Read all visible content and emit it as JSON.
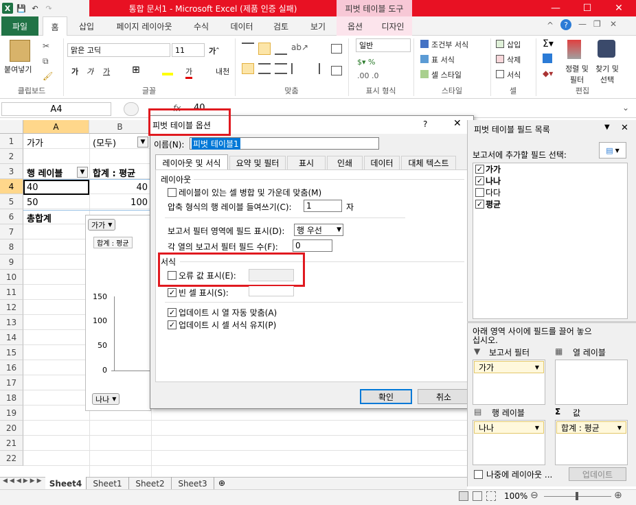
{
  "titlebar": {
    "title": "통합 문서1 - Microsoft Excel (제품 인증 실패)",
    "context_tool": "피벗 테이블 도구",
    "minimize": "—",
    "maximize": "☐",
    "close": "✕",
    "excel_logo": "X",
    "quick_access": [
      "💾",
      "↶",
      "↷"
    ]
  },
  "ribbon_tabs": {
    "file": "파일",
    "items": [
      "홈",
      "삽입",
      "페이지 레이아웃",
      "수식",
      "데이터",
      "검토",
      "보기"
    ],
    "context": [
      "옵션",
      "디자인"
    ]
  },
  "ribbon": {
    "clipboard": {
      "label": "클립보드",
      "paste": "붙여넣기"
    },
    "font": {
      "label": "글꼴",
      "font_name": "맑은 고딕",
      "font_size": "11",
      "bold": "가",
      "italic": "가",
      "underline": "가"
    },
    "alignment": {
      "label": "맞춤"
    },
    "number": {
      "label": "표시 형식",
      "format": "일반"
    },
    "styles": {
      "label": "스타일",
      "conditional": "조건부 서식",
      "table": "표 서식",
      "cell_style": "셀 스타일"
    },
    "cells": {
      "label": "셀",
      "insert": "삽입",
      "delete": "삭제",
      "format": "서식"
    },
    "editing": {
      "label": "편집",
      "sort": "정렬 및\n필터",
      "find": "찾기 및\n선택"
    }
  },
  "formula_bar": {
    "name_box": "A4",
    "fx": "fx",
    "value": "40"
  },
  "grid": {
    "columns": [
      "A",
      "B"
    ],
    "rows": [
      "1",
      "2",
      "3",
      "4",
      "5",
      "6",
      "7",
      "8",
      "9",
      "10",
      "11",
      "12",
      "13",
      "14",
      "15",
      "16",
      "17",
      "18",
      "19",
      "20",
      "21",
      "22"
    ],
    "cells": {
      "a1": "가가",
      "b1": "(모두)",
      "a3": "행 레이블",
      "b3": "합계 : 평균",
      "a4": "40",
      "b4": "40",
      "a5": "50",
      "b5": "100",
      "a6": "총합계"
    }
  },
  "chart": {
    "filter_label": "가가",
    "series_label": "합계 : 평균",
    "axis_filter": "나나",
    "y_ticks": [
      "150",
      "100",
      "50",
      "0"
    ]
  },
  "dialog": {
    "title": "피벗 테이블 옵션",
    "help": "?",
    "close": "✕",
    "name_label": "이름(N):",
    "name_value": "피벗 테이블1",
    "tabs": [
      "레이아웃 및 서식",
      "요약 및 필터",
      "표시",
      "인쇄",
      "데이터",
      "대체 텍스트"
    ],
    "layout_section": "레이아웃",
    "merge_label": "레이블이 있는 셀 병합 및 가운데 맞춤(M)",
    "indent_label": "압축 형식의 행 레이블 들여쓰기(C):",
    "indent_value": "1",
    "indent_unit": "자",
    "report_filter_label": "보고서 필터 영역에 필드 표시(D):",
    "report_filter_value": "행 우선",
    "fields_per_col_label": "각 열의 보고서 필터 필드 수(F):",
    "fields_per_col_value": "0",
    "format_section": "서식",
    "error_label": "오류 값 표시(E):",
    "empty_label": "빈 셀 표시(S):",
    "autofit_label": "업데이트 시 열 자동 맞춤(A)",
    "preserve_label": "업데이트 시 셀 서식 유지(P)",
    "ok": "확인",
    "cancel": "취소"
  },
  "field_panel": {
    "title": "피벗 테이블 필드 목록",
    "choose_label": "보고서에 추가할 필드 선택:",
    "fields": [
      {
        "name": "가가",
        "checked": true
      },
      {
        "name": "나나",
        "checked": true
      },
      {
        "name": "다다",
        "checked": false
      },
      {
        "name": "평균",
        "checked": true
      }
    ],
    "drag_hint": "아래 영역 사이에 필드를 끌어 놓으십시오.",
    "report_filter": "보고서 필터",
    "column_labels": "열 레이블",
    "row_labels": "행 레이블",
    "values": "값",
    "report_filter_chip": "가가",
    "row_chip": "나나",
    "values_chip": "합계 : 평균",
    "defer_label": "나중에 레이아웃 ...",
    "update_button": "업데이트"
  },
  "sheet_tabs": [
    "Sheet4",
    "Sheet1",
    "Sheet2",
    "Sheet3"
  ],
  "status": {
    "zoom": "100%"
  }
}
